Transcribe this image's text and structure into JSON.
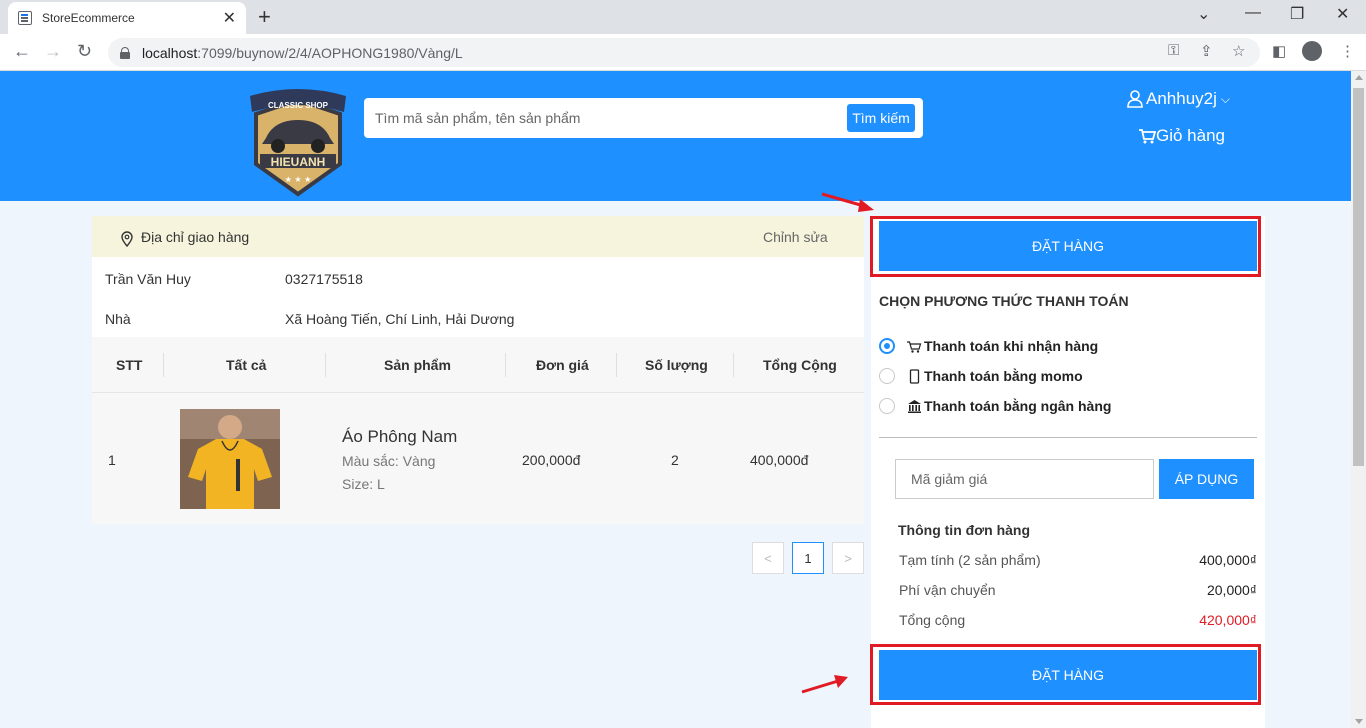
{
  "browser": {
    "tab_title": "StoreEcommerce",
    "url_host": "localhost",
    "url_path": ":7099/buynow/2/4/AOPHONG1980/Vàng/L"
  },
  "header": {
    "logo_text_top": "CLASSIC SHOP",
    "logo_text_main": "HIEUANH",
    "search_placeholder": "Tìm mã sản phẩm, tên sản phẩm",
    "search_button": "Tìm kiếm",
    "username": "Anhhuy2j",
    "cart_label": "Giỏ hàng"
  },
  "address": {
    "title": "Địa chỉ giao hàng",
    "edit_label": "Chỉnh sửa",
    "name": "Trần Văn Huy",
    "phone": "0327175518",
    "type": "Nhà",
    "detail": "Xã Hoàng Tiến, Chí Linh, Hải Dương"
  },
  "table": {
    "columns": [
      "STT",
      "Tất cả",
      "Sản phẩm",
      "Đơn giá",
      "Số lượng",
      "Tổng Cộng"
    ],
    "rows": [
      {
        "index": "1",
        "name": "Áo Phông Nam",
        "color": "Màu sắc: Vàng",
        "size": "Size: L",
        "price": "200,000đ",
        "quantity": "2",
        "total": "400,000đ"
      }
    ]
  },
  "pagination": {
    "prev": "<",
    "current": "1",
    "next": ">"
  },
  "checkout": {
    "order_button": "ĐẶT HÀNG",
    "payment_title": "CHỌN PHƯƠNG THỨC THANH TOÁN",
    "payment_methods": [
      {
        "label": "Thanh toán khi nhận hàng",
        "icon": "cart-icon",
        "selected": true
      },
      {
        "label": "Thanh toán bằng momo",
        "icon": "mobile-icon",
        "selected": false
      },
      {
        "label": "Thanh toán bằng ngân hàng",
        "icon": "bank-icon",
        "selected": false
      }
    ],
    "coupon_placeholder": "Mã giảm giá",
    "apply_button": "ÁP DỤNG",
    "info_title": "Thông tin đơn hàng",
    "subtotal_label": "Tạm tính (2 sản phẩm)",
    "subtotal_value": "400,000₫",
    "shipping_label": "Phí vận chuyển",
    "shipping_value": "20,000₫",
    "total_label": "Tổng cộng",
    "total_value": "420,000₫"
  },
  "colors": {
    "brand": "#1e90ff",
    "highlight_frame": "#e01b24",
    "total": "#e01b24"
  }
}
